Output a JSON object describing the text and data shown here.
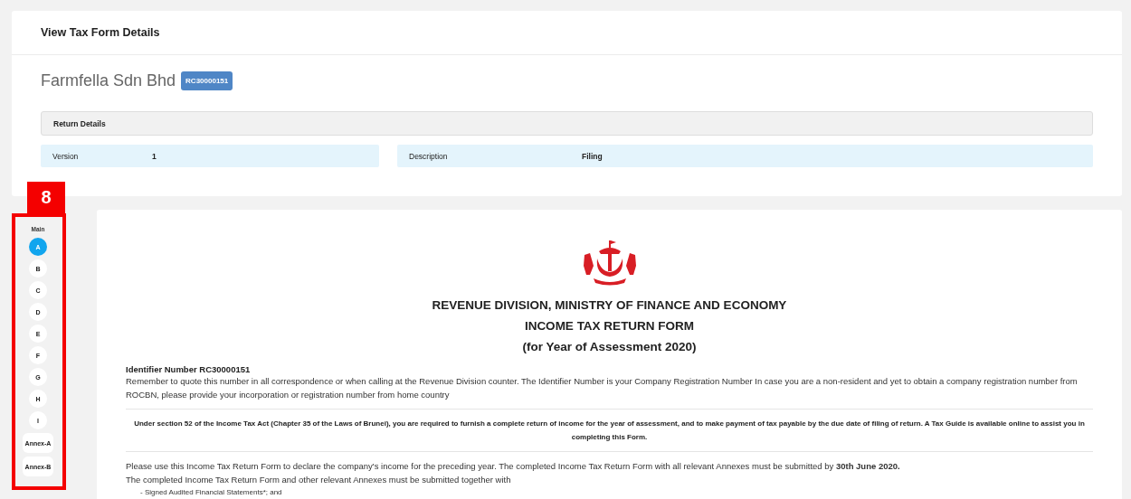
{
  "page_title": "View Tax Form Details",
  "company": {
    "name": "Farmfella Sdn Bhd",
    "badge": "RC30000151"
  },
  "return_details": {
    "heading": "Return Details",
    "fields": [
      {
        "label": "Version",
        "value": "1"
      },
      {
        "label": "Description",
        "value": "Filing"
      }
    ]
  },
  "callout": {
    "number": "8"
  },
  "section_nav": {
    "heading": "Main",
    "items": [
      {
        "label": "A",
        "selected": true
      },
      {
        "label": "B",
        "selected": false
      },
      {
        "label": "C",
        "selected": false
      },
      {
        "label": "D",
        "selected": false
      },
      {
        "label": "E",
        "selected": false
      },
      {
        "label": "F",
        "selected": false
      },
      {
        "label": "G",
        "selected": false
      },
      {
        "label": "H",
        "selected": false
      },
      {
        "label": "I",
        "selected": false
      },
      {
        "label": "Annex-A",
        "selected": false
      },
      {
        "label": "Annex-B",
        "selected": false
      }
    ]
  },
  "form": {
    "titles": [
      "REVENUE DIVISION, MINISTRY OF FINANCE AND ECONOMY",
      "INCOME TAX RETURN FORM",
      "(for Year of Assessment 2020)"
    ],
    "identifier": "Identifier Number RC30000151",
    "identifier_note": "Remember to quote this number in all correspondence or when calling at the Revenue Division counter. The Identifier Number is your Company Registration Number In case you are a non-resident and yet to obtain a company registration number from ROCBN, please provide your incorporation or registration number from home country",
    "notice": "Under section 52 of the Income Tax Act (Chapter 35 of the Laws of Brunei), you are required to furnish a complete return of income for the year of assessment, and to make payment of tax payable by the due date of filing of return. A Tax Guide is available online to assist you in completing this Form.",
    "instructions": [
      "Please use this Income Tax Return Form to declare the company's income for the preceding year. The completed Income Tax Return Form with all relevant Annexes must be submitted by **30th June 2020.**",
      "The completed Income Tax Return Form and other relevant Annexes must be submitted together with"
    ],
    "requirements": [
      "- Signed Audited Financial Statements*; and"
    ]
  }
}
